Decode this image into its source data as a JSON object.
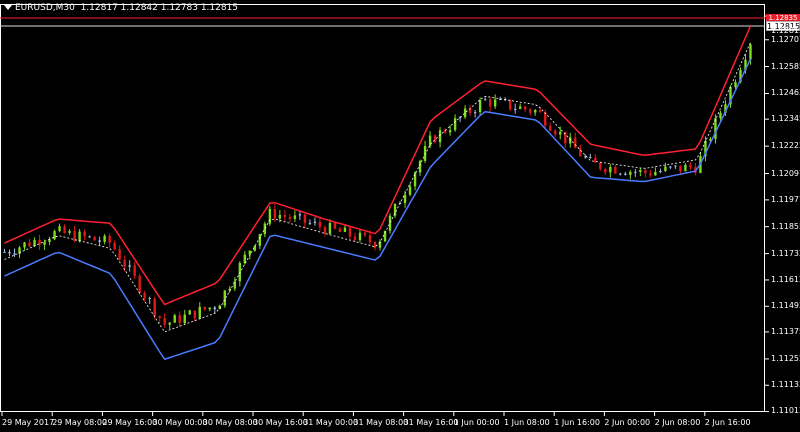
{
  "header": {
    "symbol_tf": "EURUSD,M30",
    "ohlc": "1.12817 1.12842 1.12783 1.12815"
  },
  "price_axis": [
    "1.12815",
    "1.12707",
    "1.12585",
    "1.12462",
    "1.12345",
    "1.12222",
    "1.12097",
    "1.11977",
    "1.11855",
    "1.11732",
    "1.11612",
    "1.11492",
    "1.11375",
    "1.11252",
    "1.11132",
    "1.11012"
  ],
  "time_axis": [
    "29 May 2017",
    "29 May 08:00",
    "29 May 16:00",
    "30 May 00:00",
    "30 May 08:00",
    "30 May 16:00",
    "31 May 00:00",
    "31 May 08:00",
    "31 May 16:00",
    "1 Jun 00:00",
    "1 Jun 08:00",
    "1 Jun 16:00",
    "2 Jun 00:00",
    "2 Jun 08:00",
    "2 Jun 16:00"
  ],
  "ask_label": "1.12835",
  "bid_label": "1.12815",
  "colors": {
    "bull": "#7fdc1e",
    "bear": "#e01818",
    "neutral": "#9fbfe0",
    "upper_band": "#ff2030",
    "lower_band": "#4a7cff",
    "mid_line": "#ffffff",
    "grid_line": "#888888"
  },
  "chart_data": {
    "type": "candlestick",
    "symbol": "EURUSD",
    "timeframe": "M30",
    "ylim": [
      1.1101,
      1.1287
    ],
    "x": [
      "29 May 2017",
      "29 May 08:00",
      "29 May 16:00",
      "30 May 00:00",
      "30 May 08:00",
      "30 May 16:00",
      "31 May 00:00",
      "31 May 08:00",
      "31 May 16:00",
      "1 Jun 00:00",
      "1 Jun 08:00",
      "1 Jun 16:00",
      "2 Jun 00:00",
      "2 Jun 08:00",
      "2 Jun 16:00"
    ],
    "close": [
      1.1174,
      1.1183,
      1.1178,
      1.1141,
      1.115,
      1.1192,
      1.1185,
      1.1178,
      1.1225,
      1.1243,
      1.1238,
      1.1214,
      1.121,
      1.1213,
      1.127
    ],
    "upper_band": [
      1.1178,
      1.1189,
      1.1187,
      1.115,
      1.116,
      1.1197,
      1.1189,
      1.1182,
      1.1234,
      1.1252,
      1.1248,
      1.1223,
      1.1218,
      1.1221,
      1.1277
    ],
    "lower_band": [
      1.1163,
      1.1174,
      1.1164,
      1.1125,
      1.1133,
      1.1182,
      1.1176,
      1.117,
      1.1213,
      1.1238,
      1.1234,
      1.1208,
      1.1206,
      1.1211,
      1.1262
    ]
  }
}
